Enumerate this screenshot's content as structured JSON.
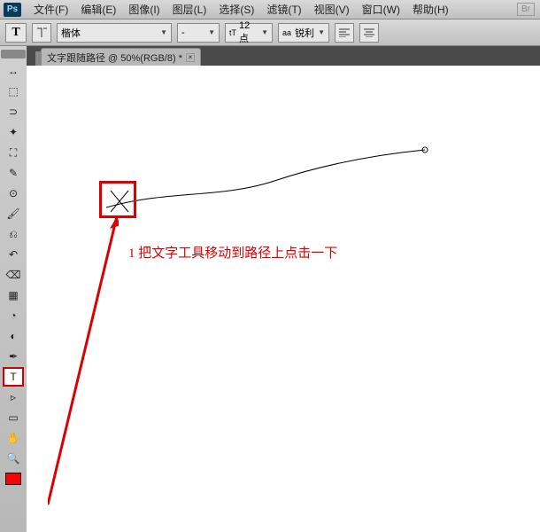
{
  "app": {
    "logo": "Ps",
    "br_badge": "Br"
  },
  "menu": {
    "file": "文件(F)",
    "edit": "编辑(E)",
    "image": "图像(I)",
    "layer": "图层(L)",
    "select": "选择(S)",
    "filter": "滤镜(T)",
    "view": "视图(V)",
    "window": "窗口(W)",
    "help": "帮助(H)"
  },
  "options": {
    "tool_indicator": "T",
    "font_family": "楷体",
    "font_style": "-",
    "size_prefix": "tT",
    "size_value": "12点",
    "aa_label": "aa",
    "aa_value": "锐利"
  },
  "document": {
    "tab_title": "文字跟随路径 @ 50%(RGB/8) *"
  },
  "annotation": {
    "step_num": "1",
    "text": "把文字工具移动到路径上点击一下"
  },
  "tools": {
    "move": "↔",
    "marquee": "⬚",
    "lasso": "⊃",
    "wand": "✦",
    "crop": "⛶",
    "eyedropper": "✎",
    "healing": "⊙",
    "brush": "🖌",
    "stamp": "⎌",
    "history": "↶",
    "eraser": "⌫",
    "gradient": "▦",
    "blur": "◔",
    "dodge": "◐",
    "pen": "✒",
    "type": "T",
    "path": "▹",
    "shape": "▭",
    "hand": "✋",
    "zoom": "🔍"
  }
}
